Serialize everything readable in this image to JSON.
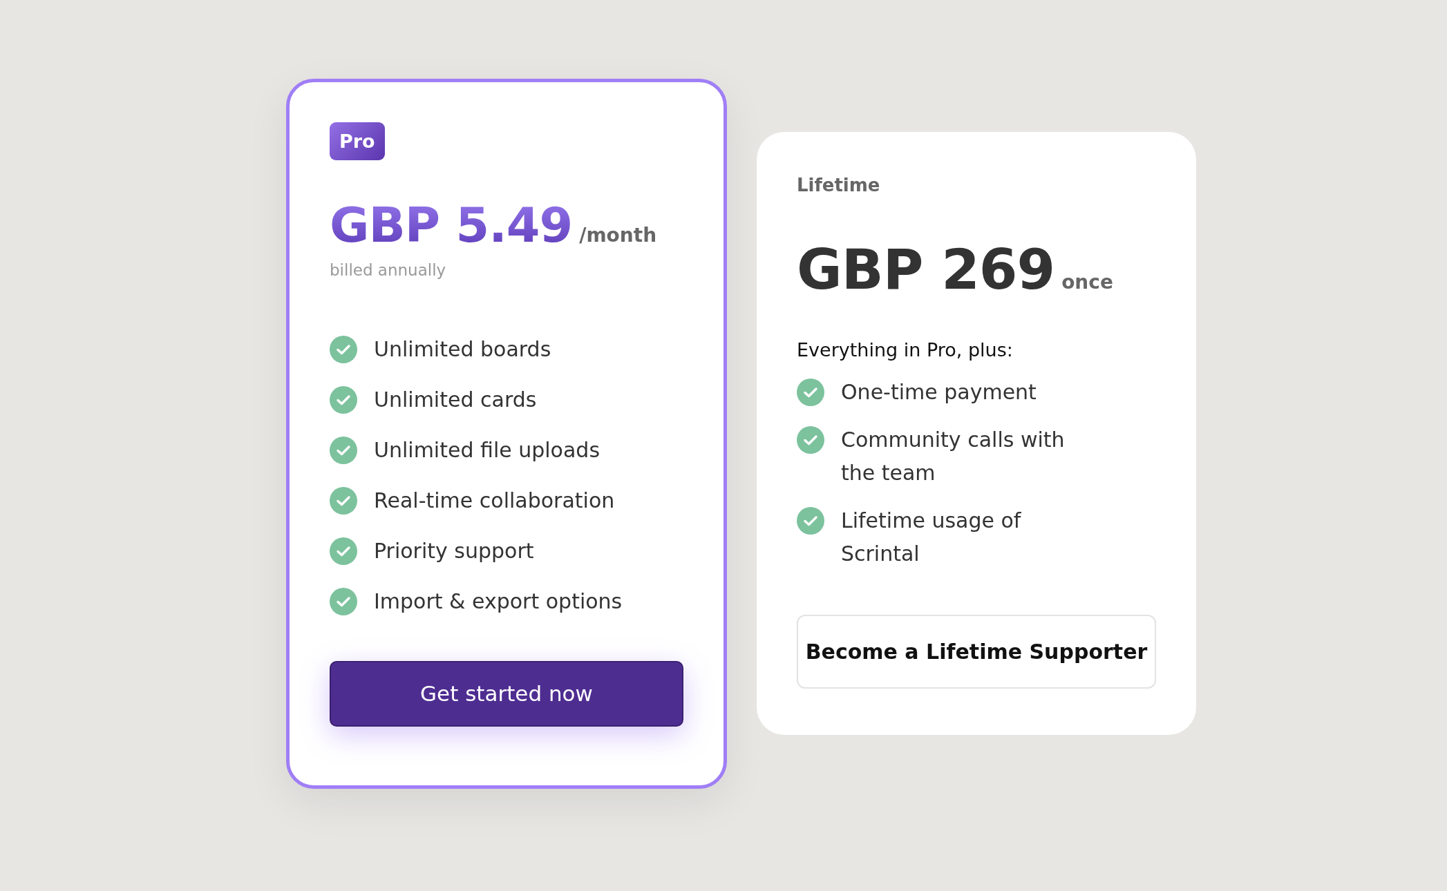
{
  "plans": [
    {
      "kind": "featured",
      "badge": "Pro",
      "price": "GBP 5.49",
      "period": "/month",
      "note": "billed annually",
      "features": [
        "Unlimited boards",
        "Unlimited cards",
        "Unlimited file uploads",
        "Real-time collaboration",
        "Priority support",
        "Import & export options"
      ],
      "button": "Get started now"
    },
    {
      "kind": "plain",
      "label": "Lifetime",
      "price": "GBP 269",
      "period": "once",
      "intro": "Everything in Pro, plus:",
      "features": [
        "One-time payment",
        "Community calls with the team",
        "Lifetime usage of Scrintal"
      ],
      "button": "Become a Lifetime Supporter"
    }
  ]
}
